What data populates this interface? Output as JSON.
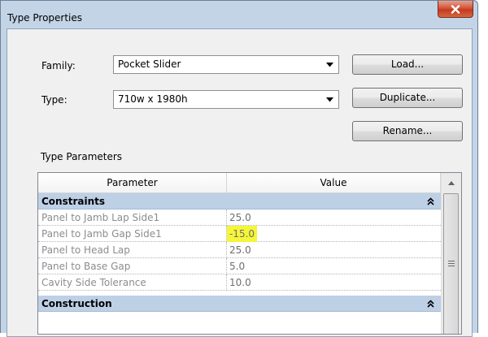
{
  "window": {
    "title": "Type Properties"
  },
  "family": {
    "label": "Family:",
    "value": "Pocket Slider"
  },
  "type": {
    "label": "Type:",
    "value": "710w x 1980h"
  },
  "buttons": {
    "load": "Load...",
    "duplicate": "Duplicate...",
    "rename": "Rename..."
  },
  "type_parameters": {
    "label": "Type Parameters"
  },
  "grid": {
    "headers": {
      "parameter": "Parameter",
      "value": "Value"
    },
    "groups": [
      {
        "name": "Constraints",
        "rows": [
          {
            "parameter": "Panel to Jamb Lap Side1",
            "value": "25.0"
          },
          {
            "parameter": "Panel to Jamb Gap Side1",
            "value": "-15.0"
          },
          {
            "parameter": "Panel to Head Lap",
            "value": "25.0"
          },
          {
            "parameter": "Panel to Base Gap",
            "value": "5.0"
          },
          {
            "parameter": "Cavity Side Tolerance",
            "value": "10.0"
          }
        ]
      },
      {
        "name": "Construction",
        "rows": []
      }
    ]
  },
  "highlight_color": "#f5f53a",
  "icons": {
    "close": "close-icon",
    "dropdown": "chevron-down-icon",
    "collapse": "double-chevron-up-icon",
    "scroll_up": "scroll-up-arrow-icon"
  }
}
